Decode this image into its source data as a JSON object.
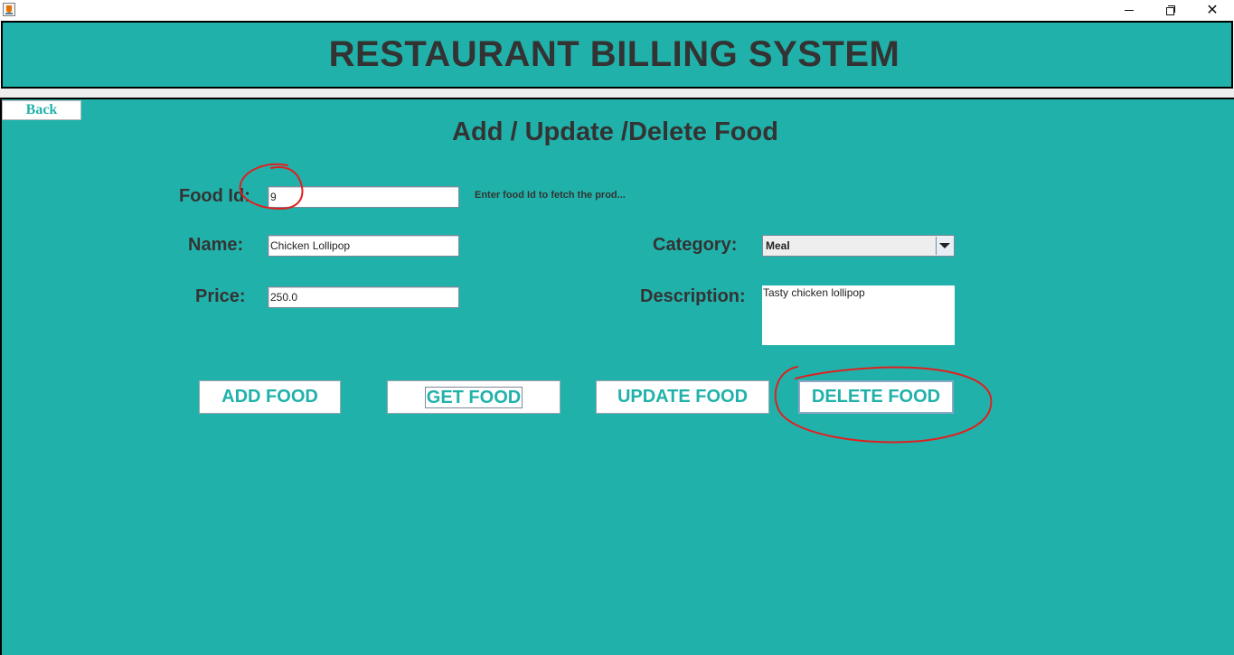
{
  "header": {
    "title": "RESTAURANT BILLING SYSTEM"
  },
  "nav": {
    "back_label": "Back"
  },
  "form": {
    "title": "Add / Update /Delete Food",
    "food_id": {
      "label": "Food Id:",
      "value": "9",
      "hint": "Enter food Id to fetch the prod..."
    },
    "name": {
      "label": "Name:",
      "value": "Chicken Lollipop"
    },
    "price": {
      "label": "Price:",
      "value": "250.0"
    },
    "category": {
      "label": "Category:",
      "selected": "Meal"
    },
    "description": {
      "label": "Description:",
      "value": "Tasty chicken lollipop"
    }
  },
  "actions": {
    "add": "ADD FOOD",
    "get": "GET FOOD",
    "update": "UPDATE FOOD",
    "delete": "DELETE FOOD"
  },
  "colors": {
    "panel_bg": "#20b2aa",
    "heading_text": "#333333",
    "button_text": "#20b2aa",
    "annotation": "#e02020"
  },
  "icons": {
    "app": "java-cup-icon",
    "minimize": "minimize-icon",
    "restore": "restore-icon",
    "close": "close-icon",
    "combo": "chevron-down-icon"
  }
}
